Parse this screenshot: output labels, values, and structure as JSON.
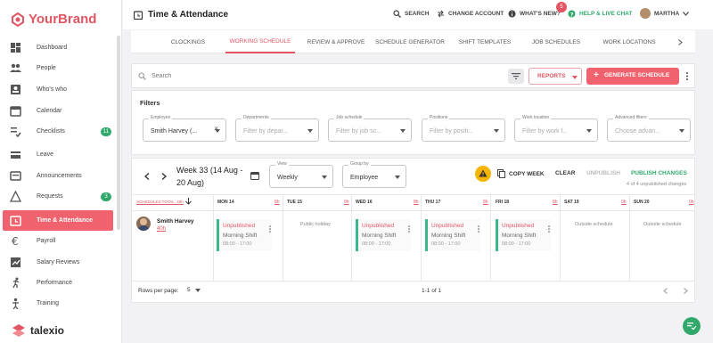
{
  "brand": {
    "name": "YourBrand",
    "accent": "#e25563"
  },
  "sidebar": {
    "items": [
      {
        "label": "Dashboard",
        "icon": "dashboard-icon"
      },
      {
        "label": "People",
        "icon": "people-icon"
      },
      {
        "label": "Who's who",
        "icon": "contact-card-icon"
      },
      {
        "label": "Calendar",
        "icon": "calendar-icon"
      },
      {
        "label": "Checklists",
        "icon": "checklist-icon",
        "badge": "11"
      },
      {
        "label": "Leave",
        "icon": "leave-icon"
      },
      {
        "label": "Announcements",
        "icon": "megaphone-icon"
      },
      {
        "label": "Requests",
        "icon": "warning-icon",
        "badge": "3"
      },
      {
        "label": "Time & Attendance",
        "icon": "clock-icon",
        "active": true
      },
      {
        "label": "Payroll",
        "icon": "euro-icon"
      },
      {
        "label": "Salary Reviews",
        "icon": "trend-icon"
      },
      {
        "label": "Performance",
        "icon": "runner-icon"
      },
      {
        "label": "Training",
        "icon": "training-icon"
      }
    ],
    "footer_logo": "talexio"
  },
  "header": {
    "title": "Time & Attendance",
    "search": "SEARCH",
    "change_account": "CHANGE ACCOUNT",
    "whats_new": "WHAT'S NEW?",
    "whats_new_badge": "5",
    "help": "HELP & LIVE CHAT",
    "user": "MARTHA"
  },
  "tabs": [
    "CLOCKINGS",
    "WORKING SCHEDULE",
    "REVIEW & APPROVE",
    "SCHEDULE GENERATOR",
    "SHIFT TEMPLATES",
    "JOB SCHEDULES",
    "WORK LOCATIONS"
  ],
  "toolbar": {
    "search_placeholder": "Search",
    "reports": "REPORTS",
    "generate": "GENERATE SCHEDULE"
  },
  "filters": {
    "title": "Filters",
    "fields": [
      {
        "label": "Employee",
        "value": "Smith Harvey (..."
      },
      {
        "label": "Departments",
        "placeholder": "Filter by depar..."
      },
      {
        "label": "Job schedule",
        "placeholder": "Filter by job sc..."
      },
      {
        "label": "Positions",
        "placeholder": "Filter by positi..."
      },
      {
        "label": "Work location",
        "placeholder": "Filter by work l..."
      },
      {
        "label": "Advanced filters",
        "placeholder": "Choose advan..."
      }
    ]
  },
  "schedule": {
    "week": "Week 33 (14 Aug - 20 Aug)",
    "view_label": "View",
    "view_value": "Weekly",
    "group_label": "Group by",
    "group_value": "Employee",
    "copy_week": "COPY WEEK",
    "clear": "CLEAR",
    "unpublish": "UNPUBLISH",
    "publish": "PUBLISH CHANGES",
    "unpublished_note": "4 of 4 unpublished changes",
    "total": "SCHEDULES TOTAL: 40h",
    "days": [
      {
        "name": "MON 14",
        "hours": "8h"
      },
      {
        "name": "TUE 15",
        "hours": "0h"
      },
      {
        "name": "WED 16",
        "hours": "8h"
      },
      {
        "name": "THU 17",
        "hours": "8h"
      },
      {
        "name": "FRI 18",
        "hours": "8h"
      },
      {
        "name": "SAT 19",
        "hours": "0h"
      },
      {
        "name": "SUN 20",
        "hours": "0h"
      }
    ],
    "employee": {
      "name": "Smith Harvey",
      "hours": "40h"
    },
    "shift": {
      "status": "Unpublished",
      "name": "Morning Shift",
      "time": "08:00 - 17:00"
    },
    "public_holiday": "Public holiday",
    "outside_schedule": "Outside schedule"
  },
  "pagination": {
    "rows_label": "Rows per page:",
    "rows_value": "5",
    "range": "1-1 of 1"
  }
}
